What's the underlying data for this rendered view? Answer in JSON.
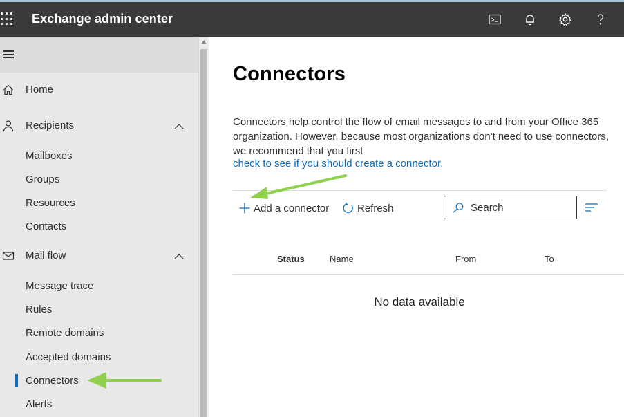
{
  "header": {
    "app_title": "Exchange admin center",
    "icons": [
      "terminal-icon",
      "bell-icon",
      "gear-icon",
      "help-icon"
    ]
  },
  "sidebar": {
    "items": [
      {
        "label": "Home",
        "icon": "home-icon"
      },
      {
        "label": "Recipients",
        "icon": "person-icon",
        "expanded": true,
        "children": [
          "Mailboxes",
          "Groups",
          "Resources",
          "Contacts"
        ]
      },
      {
        "label": "Mail flow",
        "icon": "mail-icon",
        "expanded": true,
        "children": [
          "Message trace",
          "Rules",
          "Remote domains",
          "Accepted domains",
          "Connectors",
          "Alerts"
        ]
      }
    ],
    "active": "Connectors"
  },
  "main": {
    "title": "Connectors",
    "description": "Connectors help control the flow of email messages to and from your Office 365 organization. However, because most organizations don't need to use connectors, we recommend that you first",
    "link_text": "check to see if you should create a connector.",
    "toolbar": {
      "add_label": "Add a connector",
      "refresh_label": "Refresh",
      "search_placeholder": "Search"
    },
    "table": {
      "columns": [
        "Status",
        "Name",
        "From",
        "To"
      ],
      "empty_text": "No data available"
    }
  },
  "colors": {
    "header_bg": "#3b3a39",
    "sidebar_bg": "#e8e8e8",
    "accent": "#0f6cbd",
    "annotation_arrow": "#8fd14f"
  }
}
